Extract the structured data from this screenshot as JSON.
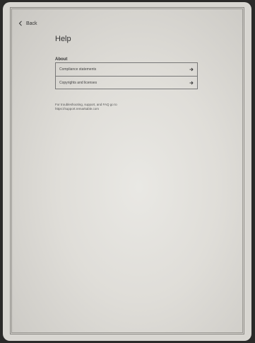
{
  "nav": {
    "back_label": "Back"
  },
  "page": {
    "title": "Help"
  },
  "about": {
    "heading": "About",
    "items": [
      {
        "label": "Compliance statements"
      },
      {
        "label": "Copyrights and licenses"
      }
    ]
  },
  "support": {
    "text": "For troubleshooting, support, and FAQ go to",
    "link": "https://support.remarkable.com"
  },
  "icons": {
    "back": "chevron-left-icon",
    "item_arrow": "arrow-right-icon"
  }
}
